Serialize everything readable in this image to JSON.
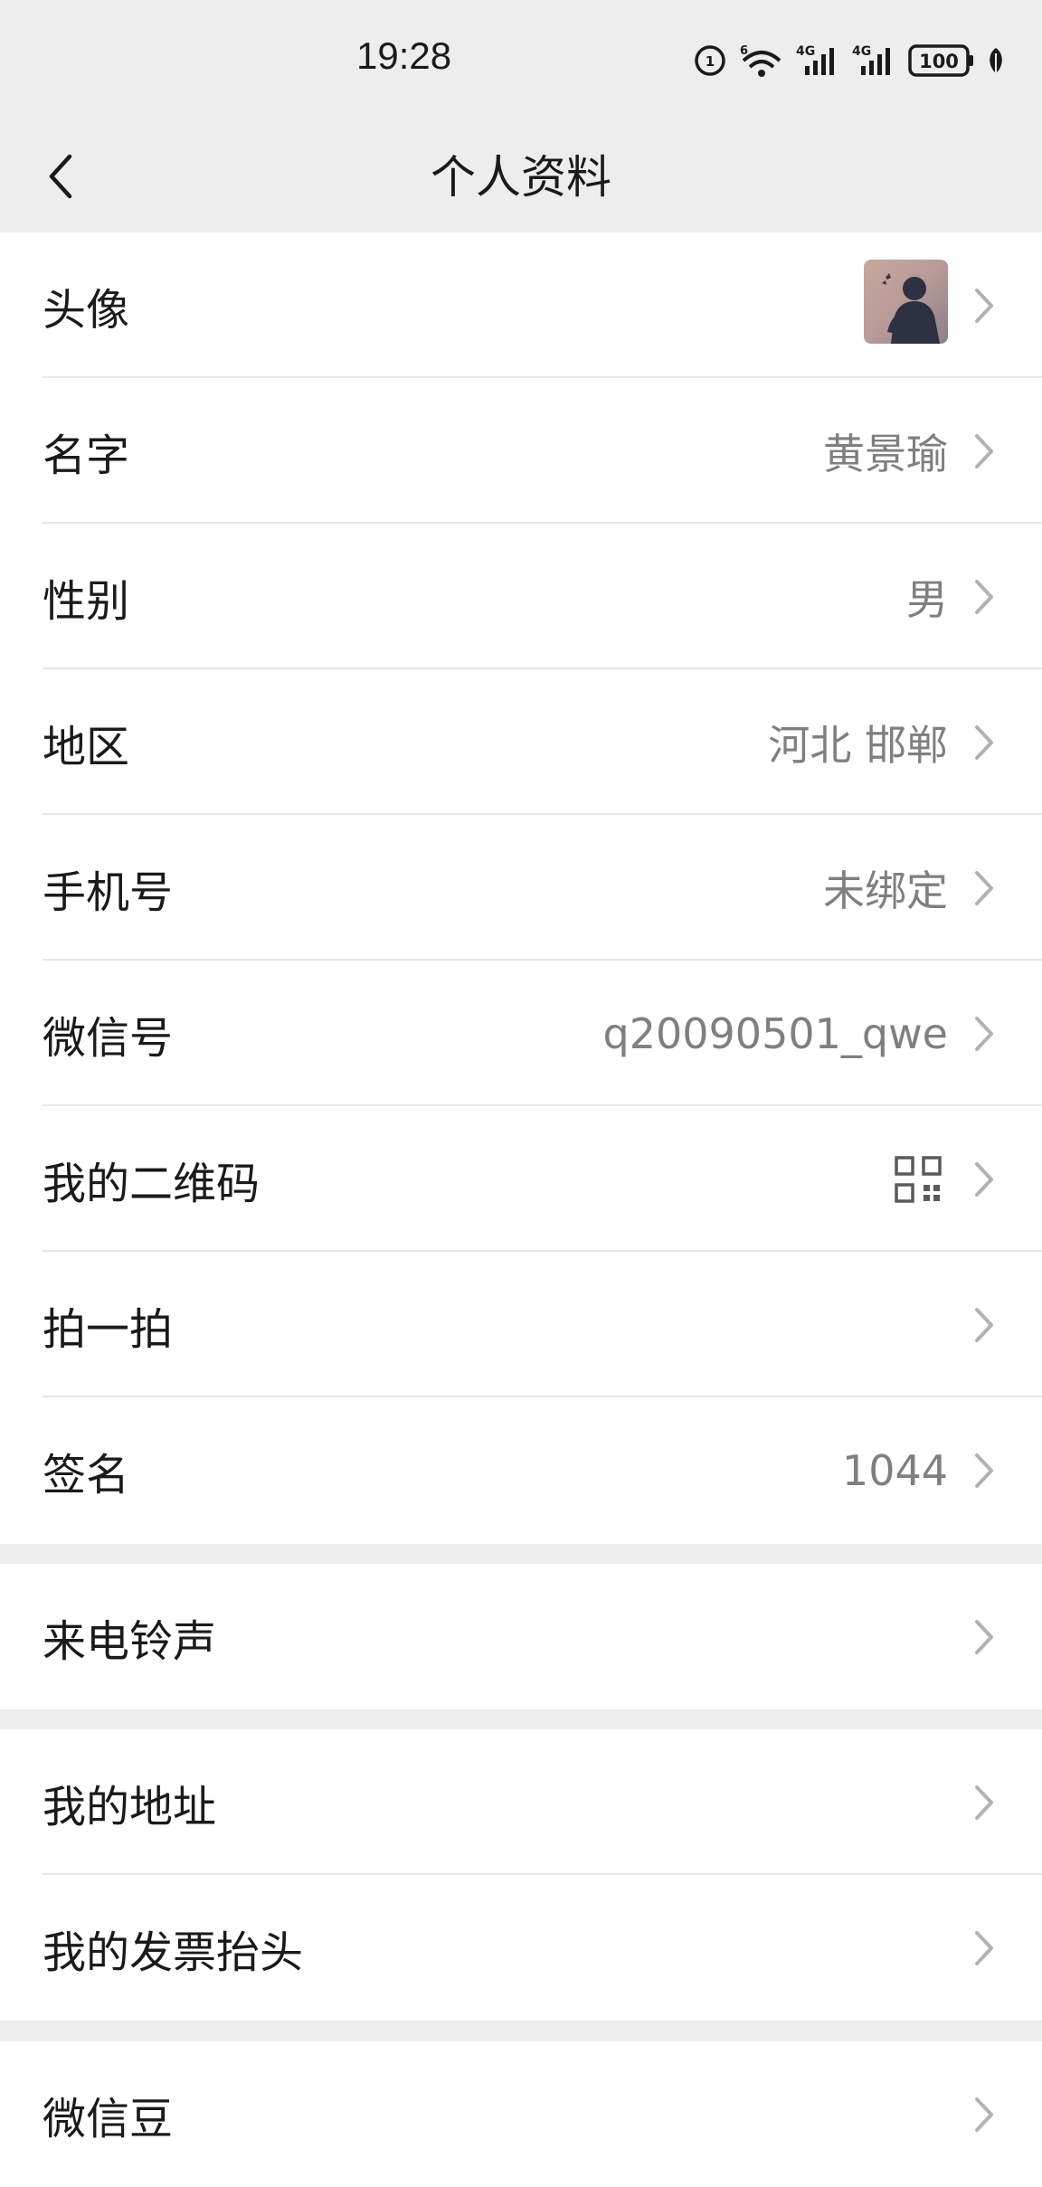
{
  "status_bar": {
    "time": "19:28",
    "wifi_label": "6",
    "signal1_label": "4G",
    "signal2_label": "4G",
    "battery": "100"
  },
  "nav": {
    "title": "个人资料",
    "back_icon": "chevron-left-icon"
  },
  "profile_items": [
    {
      "label": "头像",
      "value": "",
      "type": "avatar"
    },
    {
      "label": "名字",
      "value": "黄景瑜"
    },
    {
      "label": "性别",
      "value": "男"
    },
    {
      "label": "地区",
      "value": "河北 邯郸"
    },
    {
      "label": "手机号",
      "value": "未绑定"
    },
    {
      "label": "微信号",
      "value": "q20090501_qwe"
    },
    {
      "label": "我的二维码",
      "value": "",
      "type": "qr-code"
    },
    {
      "label": "拍一拍",
      "value": ""
    },
    {
      "label": "签名",
      "value": "1044"
    }
  ],
  "ringtone_items": [
    {
      "label": "来电铃声"
    }
  ],
  "address_items": [
    {
      "label": "我的地址"
    },
    {
      "label": "我的发票抬头"
    }
  ],
  "bean_items": [
    {
      "label": "微信豆"
    }
  ],
  "colors": {
    "background": "#ededed",
    "card": "#ffffff",
    "text_primary": "#1a1a1a",
    "text_secondary": "#7f7f7f",
    "divider": "#e6e6e6",
    "chevron": "#b2b2b2"
  }
}
